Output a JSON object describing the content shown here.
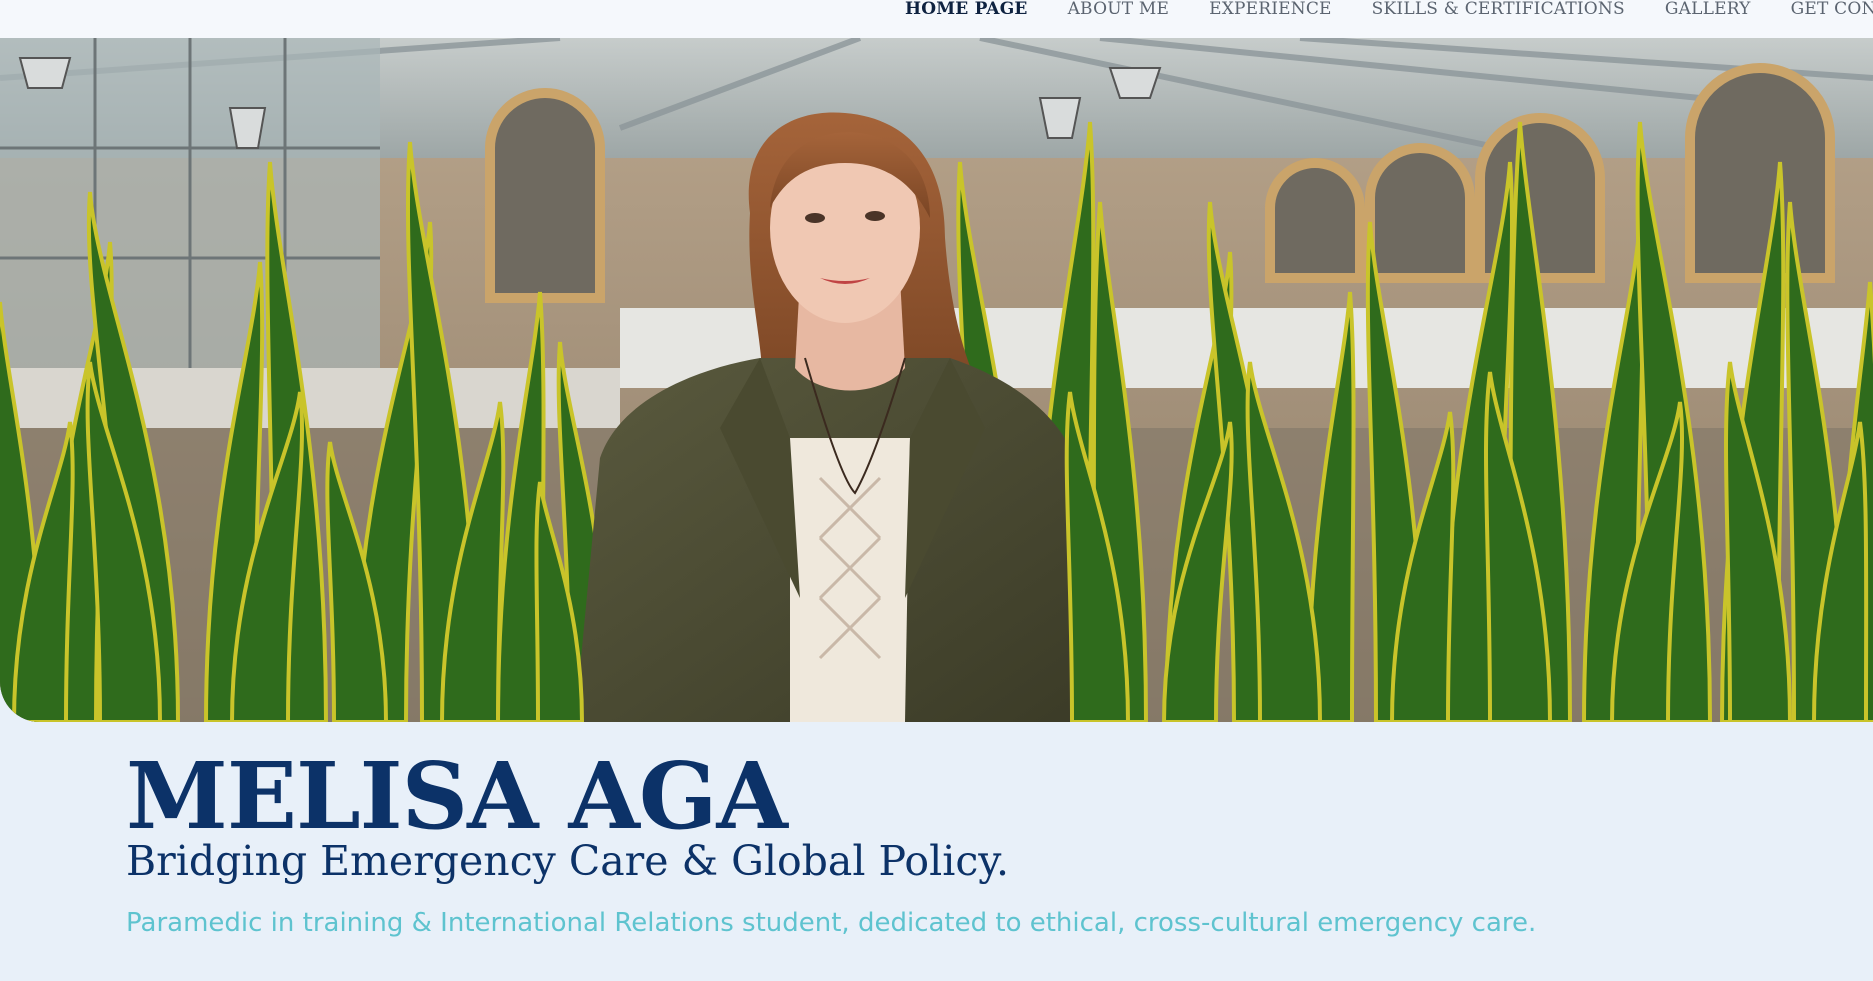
{
  "nav": {
    "items": [
      {
        "label": "HOME PAGE",
        "active": true
      },
      {
        "label": "ABOUT ME",
        "active": false
      },
      {
        "label": "EXPERIENCE",
        "active": false
      },
      {
        "label": "SKILLS & CERTIFICATIONS",
        "active": false
      },
      {
        "label": "GALLERY",
        "active": false
      },
      {
        "label": "GET CONTAC",
        "active": false
      }
    ]
  },
  "hero": {
    "name": "MELISA AGA",
    "tagline": "Bridging Emergency Care & Global Policy.",
    "description": "Paramedic in training & International Relations student, dedicated to ethical, cross-cultural emergency care."
  },
  "colors": {
    "brand_navy": "#0c3268",
    "accent_teal": "#5ec3cf",
    "page_bg": "#e8f0f9",
    "plant_green": "#2f6b1c",
    "plant_yellow": "#c9c42a"
  }
}
